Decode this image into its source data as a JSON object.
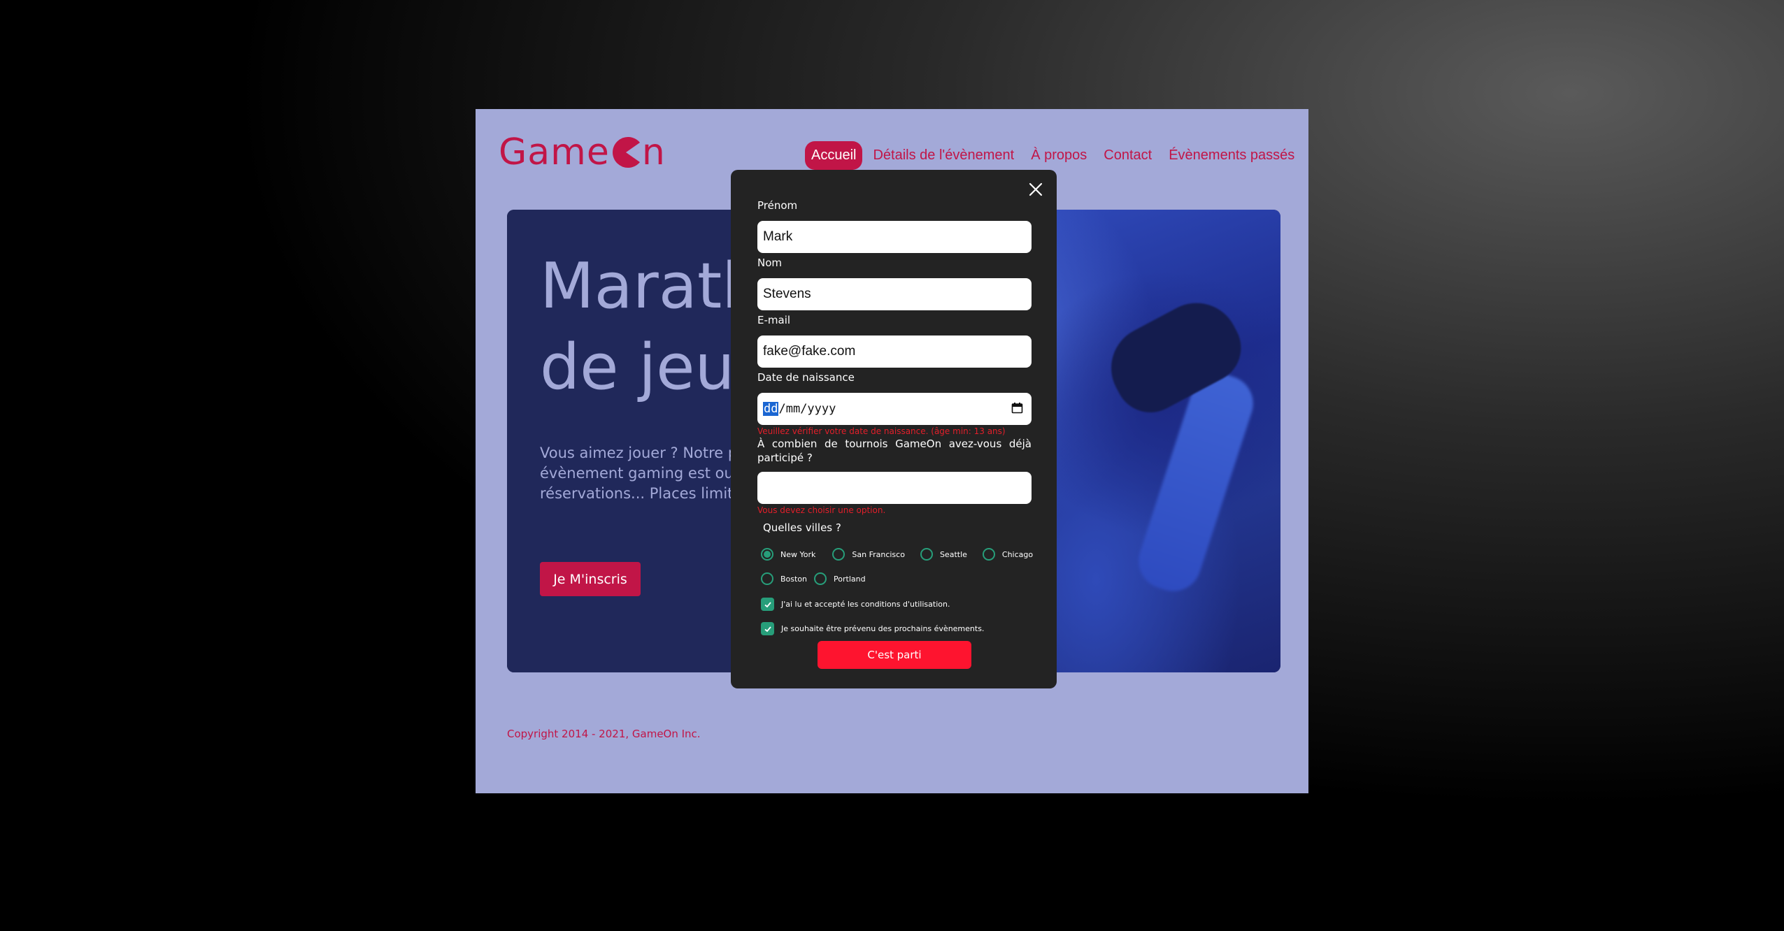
{
  "header": {
    "logo_left": "Game",
    "logo_right": "n",
    "nav": [
      {
        "label": "Accueil",
        "active": true
      },
      {
        "label": "Détails de l'évènement"
      },
      {
        "label": "À propos"
      },
      {
        "label": "Contact"
      },
      {
        "label": "Évènements passés"
      }
    ]
  },
  "hero": {
    "title_line1": "Marathon",
    "title_line2": "de jeux",
    "text": "Vous aimez jouer ? Notre prochain évènement gaming est ouvert aux réservations... Places limitées !",
    "button": "Je M'inscris"
  },
  "footer": {
    "copyright": "Copyright 2014 - 2021, GameOn Inc."
  },
  "modal": {
    "first_label": "Prénom",
    "first_value": "Mark",
    "last_label": "Nom",
    "last_value": "Stevens",
    "email_label": "E-mail",
    "email_value": "fake@fake.com",
    "birth_label": "Date de naissance",
    "birth_dd": "dd",
    "birth_rest": "/mm/yyyy",
    "birth_error": "Veuillez vérifier votre date de naissance. (âge min: 13 ans)",
    "tournaments_question": "À combien de tournois GameOn avez-vous déjà participé ?",
    "tournaments_value": "",
    "tournaments_error": "Vous devez choisir une option.",
    "cities_question": "Quelles villes ?",
    "cities": [
      {
        "label": "New York",
        "checked": true
      },
      {
        "label": "San Francisco",
        "checked": false
      },
      {
        "label": "Seattle",
        "checked": false
      },
      {
        "label": "Chicago",
        "checked": false
      },
      {
        "label": "Boston",
        "checked": false
      },
      {
        "label": "Portland",
        "checked": false
      }
    ],
    "terms_label": "J'ai lu et accepté les conditions d'utilisation.",
    "newsletter_label": "Je souhaite être prévenu des prochains évènements.",
    "submit": "C'est parti"
  },
  "colors": {
    "brand": "#c11547",
    "accent": "#279e7a",
    "submit": "#fe142f",
    "modal": "#232323"
  }
}
